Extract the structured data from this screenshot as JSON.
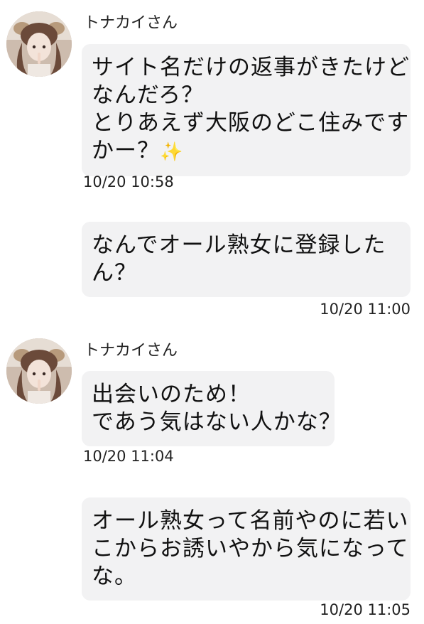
{
  "messages": [
    {
      "direction": "incoming",
      "sender": "トナカイさん",
      "lines": [
        "サイト名だけの返事がきたけど",
        "なんだろ？",
        "とりあえず大阪のどこ住みです",
        "かー？"
      ],
      "emoji": "sparkles-icon",
      "timestamp": "10/20 10:58"
    },
    {
      "direction": "outgoing",
      "lines": [
        "なんでオール熟女に登録した",
        "ん？"
      ],
      "timestamp": "10/20 11:00"
    },
    {
      "direction": "incoming",
      "sender": "トナカイさん",
      "lines": [
        "出会いのため！",
        "であう気はない人かな？"
      ],
      "timestamp": "10/20 11:04"
    },
    {
      "direction": "outgoing",
      "lines": [
        "オール熟女って名前やのに若い",
        "こからお誘いやから気になって",
        "な。"
      ],
      "timestamp": "10/20 11:05"
    }
  ],
  "colors": {
    "bubble": "#f2f2f3",
    "text": "#111111",
    "background": "#ffffff",
    "sparkle": "#f3c623"
  }
}
